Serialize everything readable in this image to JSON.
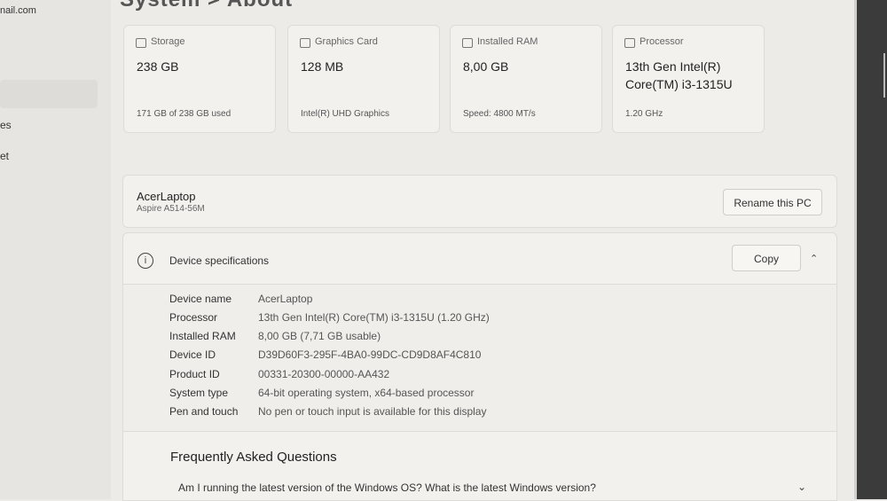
{
  "sidebar": {
    "email": "nail.com",
    "items": [
      "es",
      "et"
    ]
  },
  "page": {
    "heading": "System  >  About"
  },
  "cards": [
    {
      "icon": "storage-icon",
      "title": "Storage",
      "value": "238 GB",
      "sub": "171 GB of 238 GB used"
    },
    {
      "icon": "graphics-card-icon",
      "title": "Graphics Card",
      "value": "128 MB",
      "sub": "Intel(R) UHD Graphics"
    },
    {
      "icon": "ram-icon",
      "title": "Installed RAM",
      "value": "8,00 GB",
      "sub": "Speed: 4800 MT/s"
    },
    {
      "icon": "processor-icon",
      "title": "Processor",
      "value": "13th Gen Intel(R) Core(TM) i3-1315U",
      "sub": "1.20 GHz"
    }
  ],
  "pc": {
    "name": "AcerLaptop",
    "model": "Aspire A514-56M",
    "rename_label": "Rename this PC"
  },
  "specs": {
    "title": "Device specifications",
    "copy_label": "Copy",
    "rows": [
      {
        "label": "Device name",
        "value": "AcerLaptop"
      },
      {
        "label": "Processor",
        "value": "13th Gen Intel(R) Core(TM) i3-1315U (1.20 GHz)"
      },
      {
        "label": "Installed RAM",
        "value": "8,00 GB (7,71 GB usable)"
      },
      {
        "label": "Device ID",
        "value": "D39D60F3-295F-4BA0-99DC-CD9D8AF4C810"
      },
      {
        "label": "Product ID",
        "value": "00331-20300-00000-AA432"
      },
      {
        "label": "System type",
        "value": "64-bit operating system, x64-based processor"
      },
      {
        "label": "Pen and touch",
        "value": "No pen or touch input is available for this display"
      }
    ]
  },
  "faq": {
    "title": "Frequently Asked Questions",
    "question": "Am I running the latest version of the Windows OS? What is the latest Windows version?"
  }
}
